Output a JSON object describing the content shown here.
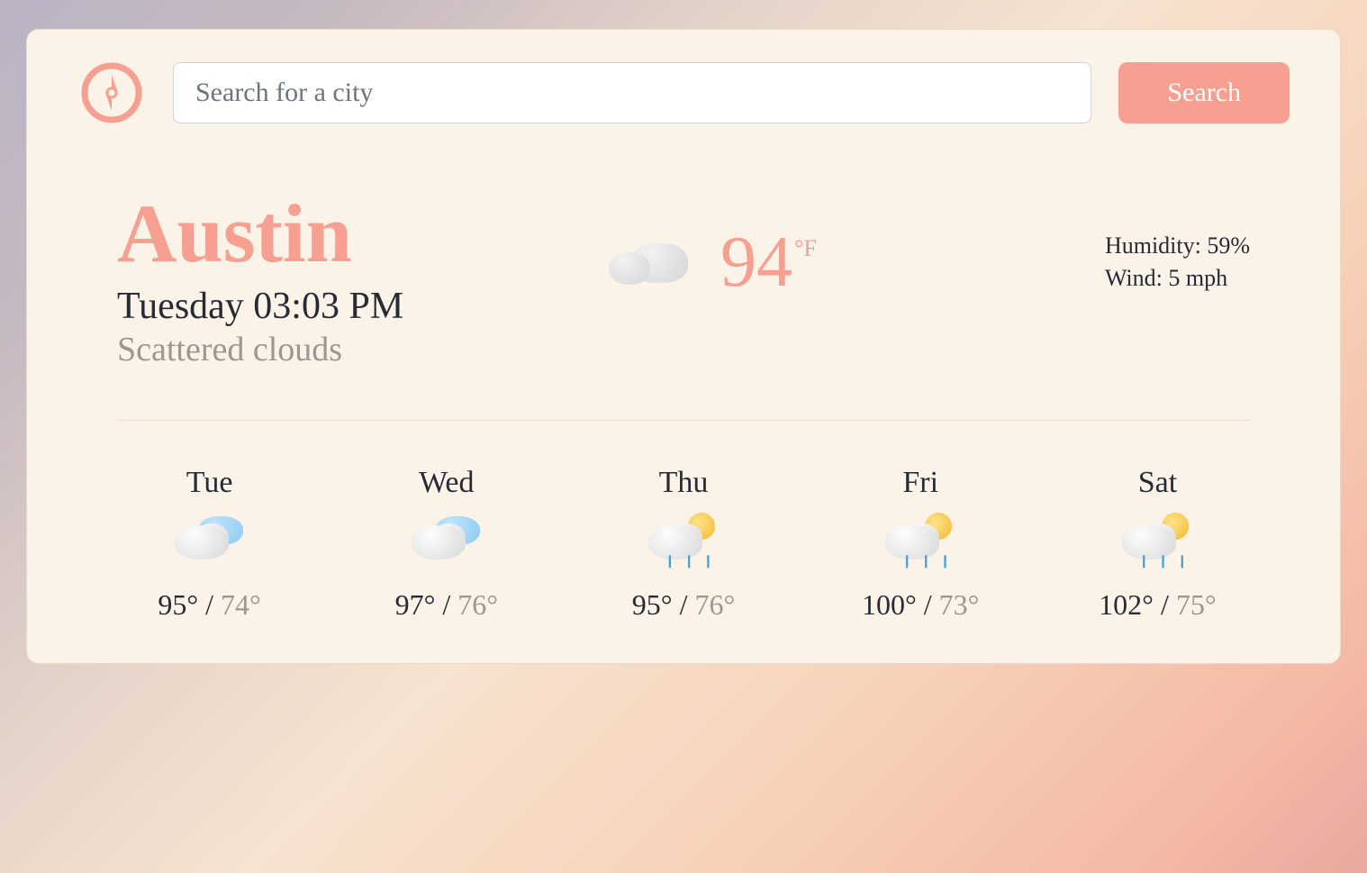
{
  "search": {
    "placeholder": "Search for a city",
    "button_label": "Search"
  },
  "current": {
    "city": "Austin",
    "datetime": "Tuesday 03:03 PM",
    "description": "Scattered clouds",
    "temp": "94",
    "temp_unit": "°F",
    "humidity_label": "Humidity: 59%",
    "wind_label": "Wind: 5 mph"
  },
  "forecast": [
    {
      "day": "Tue",
      "icon": "partly-cloudy",
      "hi": "95°",
      "lo": "74°"
    },
    {
      "day": "Wed",
      "icon": "partly-cloudy",
      "hi": "97°",
      "lo": "76°"
    },
    {
      "day": "Thu",
      "icon": "rain-sun",
      "hi": "95°",
      "lo": "76°"
    },
    {
      "day": "Fri",
      "icon": "rain-sun",
      "hi": "100°",
      "lo": "73°"
    },
    {
      "day": "Sat",
      "icon": "rain-sun",
      "hi": "102°",
      "lo": "75°"
    }
  ]
}
